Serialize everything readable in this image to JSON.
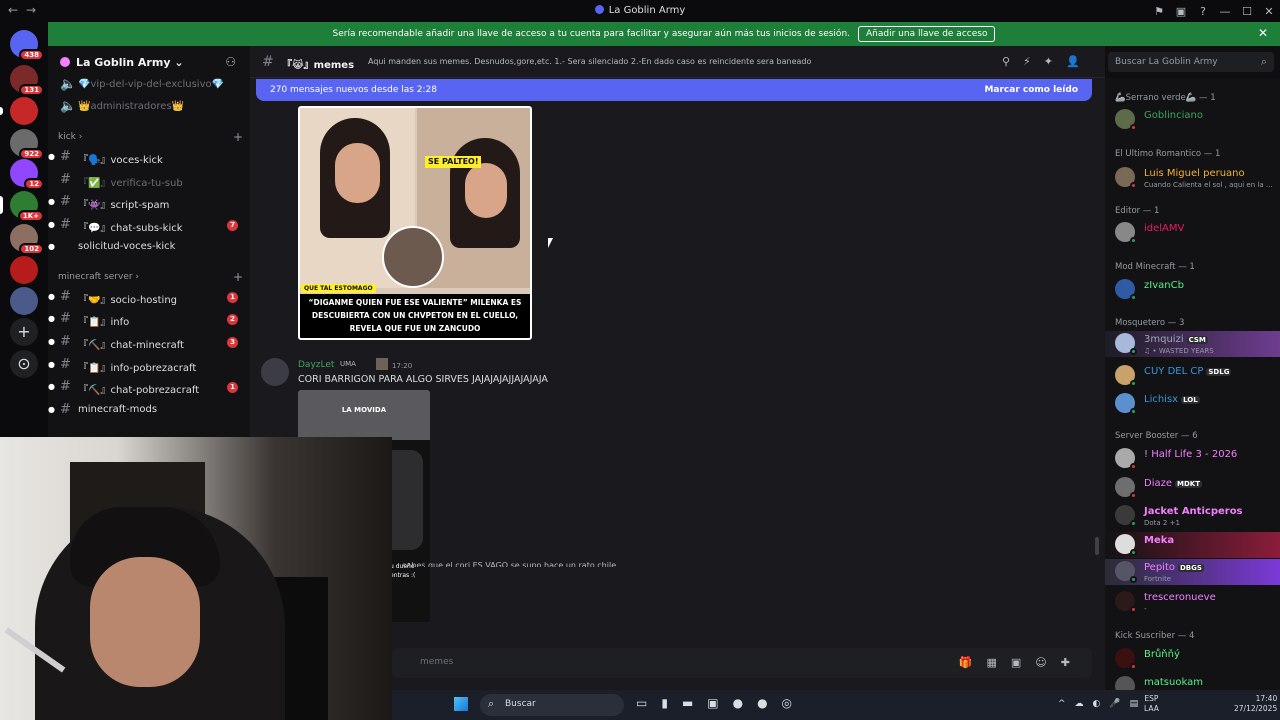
{
  "window": {
    "title": "La Goblin Army"
  },
  "banner": {
    "text": "Sería recomendable añadir una llave de acceso a tu cuenta para facilitar y asegurar aún más tus inicios de sesión.",
    "button": "Añadir una llave de acceso"
  },
  "servers": [
    {
      "badge": "438"
    },
    {
      "badge": "131"
    },
    {
      "badge": ""
    },
    {
      "badge": "922"
    },
    {
      "badge": "12"
    },
    {
      "badge": "1K+"
    },
    {
      "badge": "102"
    },
    {
      "badge": ""
    },
    {
      "badge": ""
    }
  ],
  "guild": {
    "name": "La Goblin Army"
  },
  "channels": {
    "top": [
      {
        "name": "💎vip-del-vip-del-exclusivo💎",
        "muted": true
      },
      {
        "name": "👑administradores👑",
        "muted": true
      }
    ],
    "cat_kick": "kick",
    "kick": [
      {
        "name": "『🗣️』voces-kick",
        "count": ""
      },
      {
        "name": "『✅』verifica-tu-sub",
        "count": ""
      },
      {
        "name": "『👾』script-spam",
        "count": ""
      },
      {
        "name": "『💬』chat-subs-kick",
        "count": "7"
      },
      {
        "name": "solicitud-voces-kick",
        "count": ""
      }
    ],
    "cat_mc": "minecraft server",
    "mc": [
      {
        "name": "『🤝』socio-hosting",
        "count": "1"
      },
      {
        "name": "『📋』info",
        "count": "2"
      },
      {
        "name": "『⛏️』chat-minecraft",
        "count": "3"
      },
      {
        "name": "『📋』info-pobrezacraft",
        "count": ""
      },
      {
        "name": "『⛏️』chat-pobrezacraft",
        "count": "1"
      },
      {
        "name": "minecraft-mods",
        "count": ""
      }
    ]
  },
  "chat": {
    "channel": "『😹』memes",
    "topic": "Aqui manden sus memes. Desnudos,gore,etc. 1.- Sera silenciado 2.-En dado caso es reincidente sera baneado",
    "new_messages": "270 mensajes nuevos desde las 2:28",
    "mark_read": "Marcar como leído",
    "meme": {
      "se_palteo": "SE PALTEO!",
      "label": "QUE TAL ESTOMAGO",
      "caption": "“DIGANME QUIEN FUE ESE VALIENTE” MILENKA ES DESCUBIERTA CON UN CHVPETON EN EL CUELLO, REVELA QUE FUE UN ZANCUDO"
    },
    "message2": {
      "user": "DayzLet",
      "tag": "UMA",
      "time": "17:20",
      "text": "CORI BARRIGON PARA ALGO SIRVES JAJAJAJAJJAJAJAJA",
      "video_title": "LA MOVIDA",
      "video_sub": "u dueño\nentras :("
    },
    "partial": "... sabes que el cori ES VAGO se supo hace un rato chile",
    "composer_placeholder": "memes"
  },
  "search": {
    "placeholder": "Buscar La Goblin Army"
  },
  "members": {
    "groups": [
      {
        "label": "🦾Serrano verde🦾 — 1",
        "members": [
          {
            "name": "Goblinciano",
            "color": "#3ba55d",
            "sub": "",
            "tag": ""
          }
        ]
      },
      {
        "label": "El Ultimo Romantico — 1",
        "members": [
          {
            "name": "Luis Miguel peruano",
            "color": "#f0b232",
            "sub": "Cuando Calienta el sol , aqui en la ...",
            "tag": ""
          }
        ]
      },
      {
        "label": "Editor — 1",
        "members": [
          {
            "name": "idelAMV",
            "color": "#e91e63",
            "sub": "",
            "tag": ""
          }
        ]
      },
      {
        "label": "Mod Minecraft — 1",
        "members": [
          {
            "name": "zIvanCb",
            "color": "#57f287",
            "sub": "",
            "tag": ""
          }
        ]
      },
      {
        "label": "Mosquetero — 3",
        "members": [
          {
            "name": "3mquizi",
            "color": "#99aab5",
            "sub": "♫ • WASTED YEARS",
            "tag": "CSM"
          },
          {
            "name": "CUY DEL CP",
            "color": "#3498db",
            "sub": "",
            "tag": "SDLG"
          },
          {
            "name": "Lichisx",
            "color": "#3498db",
            "sub": "",
            "tag": "LOL"
          }
        ]
      },
      {
        "label": "Server Booster — 6",
        "members": [
          {
            "name": "! Half Life 3 - 2026",
            "color": "#f47fff",
            "sub": "",
            "tag": ""
          },
          {
            "name": "Diaze",
            "color": "#f47fff",
            "sub": "",
            "tag": "MDKT"
          },
          {
            "name": "Jacket Anticperos",
            "color": "#f47fff",
            "sub": "Dota 2 +1",
            "tag": ""
          },
          {
            "name": "Meka",
            "color": "#f47fff",
            "sub": "",
            "tag": ""
          },
          {
            "name": "Pepito",
            "color": "#f47fff",
            "sub": "Fortnite",
            "tag": "DBGS"
          },
          {
            "name": "tresceronueve",
            "color": "#f47fff",
            "sub": "-",
            "tag": ""
          }
        ]
      },
      {
        "label": "Kick Suscriber — 4",
        "members": [
          {
            "name": "Brůňňý",
            "color": "#57f287",
            "sub": "",
            "tag": ""
          },
          {
            "name": "matsuokam",
            "color": "#57f287",
            "sub": "",
            "tag": ""
          }
        ]
      }
    ]
  },
  "taskbar": {
    "search": "Buscar",
    "lang1": "ESP",
    "lang2": "LAA",
    "time": "17:40",
    "date": "27/12/2025"
  }
}
